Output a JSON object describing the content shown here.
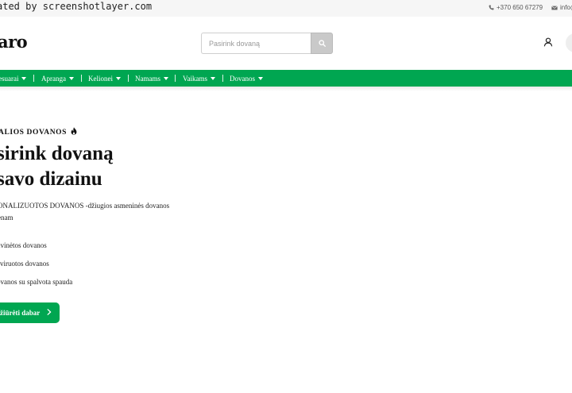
{
  "watermark": "ated by screenshotlayer.com",
  "contact": {
    "phone": "+370 650 67279",
    "email": "info@",
    "phone_icon": "phone-icon",
    "email_icon": "envelope-icon"
  },
  "header": {
    "logo": "aro",
    "search_placeholder": "Pasirink dovaną",
    "search_icon": "search-icon",
    "user_icon": "user-icon"
  },
  "nav": {
    "items": [
      {
        "label": "esuarai"
      },
      {
        "label": "Apranga"
      },
      {
        "label": "Kelionei"
      },
      {
        "label": "Namams"
      },
      {
        "label": "Vaikams"
      },
      {
        "label": "Dovanos"
      }
    ]
  },
  "hero": {
    "label": "ALIOS DOVANOS",
    "label_icon": "fire-icon",
    "title_line1": "sirink dovaną",
    "title_line2": "savo dizainu",
    "desc_line1": "ONALIZUOTOS DOVANOS -džiugios asmeninės dovanos",
    "desc_line2": "enam",
    "features": [
      "uvinėtos dovanos",
      "aviruotos dovanos",
      "ovanos su spalvota spauda"
    ],
    "cta_label": "žiūrėti dabar",
    "cta_icon": "chevron-right-icon"
  },
  "colors": {
    "brand_green": "#00a651",
    "topbar_bg": "#f6f6f6",
    "search_button_bg": "#c9c9c9"
  }
}
